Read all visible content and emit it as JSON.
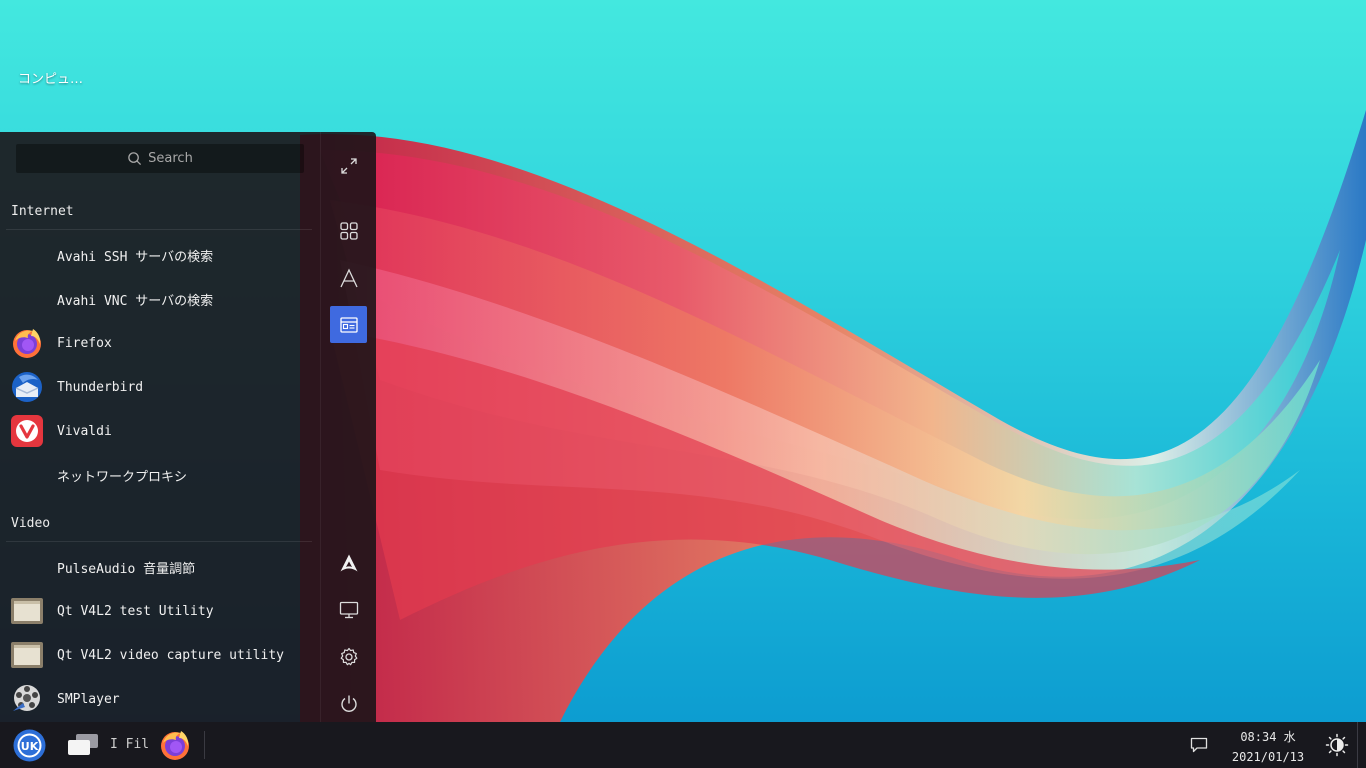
{
  "desktop": {
    "icon_label": "コンピュ…"
  },
  "menu": {
    "search_placeholder": "Search",
    "categories": [
      {
        "name": "Internet",
        "items": [
          {
            "label": "Avahi SSH サーバの検索",
            "icon": "none"
          },
          {
            "label": "Avahi VNC サーバの検索",
            "icon": "none"
          },
          {
            "label": "Firefox",
            "icon": "firefox-icon"
          },
          {
            "label": "Thunderbird",
            "icon": "thunderbird-icon"
          },
          {
            "label": "Vivaldi",
            "icon": "vivaldi-icon"
          },
          {
            "label": "ネットワークプロキシ",
            "icon": "none"
          }
        ]
      },
      {
        "name": "Video",
        "items": [
          {
            "label": "PulseAudio 音量調節",
            "icon": "none"
          },
          {
            "label": "Qt V4L2 test Utility",
            "icon": "generic-app-icon"
          },
          {
            "label": "Qt V4L2 video capture utility",
            "icon": "generic-app-icon"
          },
          {
            "label": "SMPlayer",
            "icon": "smplayer-icon"
          }
        ]
      }
    ],
    "side_buttons": [
      {
        "name": "fullscreen-icon",
        "active": false
      },
      {
        "name": "all-apps-grid-icon",
        "active": false
      },
      {
        "name": "letter-sort-icon",
        "active": false
      },
      {
        "name": "category-view-icon",
        "active": true
      },
      {
        "name": "arch-logo-icon",
        "active": false
      },
      {
        "name": "computer-icon",
        "active": false
      },
      {
        "name": "settings-gear-icon",
        "active": false
      },
      {
        "name": "power-icon",
        "active": false
      }
    ]
  },
  "taskbar": {
    "files_label": "I Fil",
    "time": "08:34 水",
    "date": "2021/01/13"
  },
  "colors": {
    "accent": "#3f6ae0",
    "taskbar_bg": "#18181e",
    "menu_bg": "#1c1418"
  }
}
